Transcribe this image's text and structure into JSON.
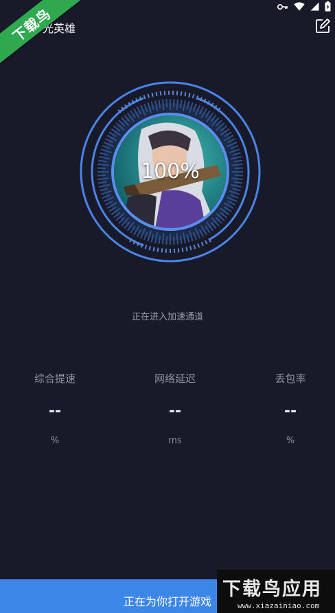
{
  "header": {
    "title": "光英雄"
  },
  "ribbon": {
    "text": "下载鸟"
  },
  "dial": {
    "progress_label": "100%",
    "progress_value": 100
  },
  "status_text": "正在进入加速通道",
  "stats": [
    {
      "label": "综合提速",
      "value": "--",
      "unit": "%"
    },
    {
      "label": "网络延迟",
      "value": "--",
      "unit": "ms"
    },
    {
      "label": "丢包率",
      "value": "--",
      "unit": "%"
    }
  ],
  "bottom_bar": {
    "label": "正在为你打开游戏"
  },
  "watermark": {
    "title": "下载鸟应用",
    "url": "www.xiazainiao.com"
  },
  "colors": {
    "background": "#181a2a",
    "accent_blue": "#3c86e8",
    "ribbon_green": "#2fa84f"
  },
  "icons": {
    "status": [
      "key-icon",
      "wifi-icon",
      "signal-icon",
      "battery-icon"
    ],
    "header": "edit-icon"
  }
}
